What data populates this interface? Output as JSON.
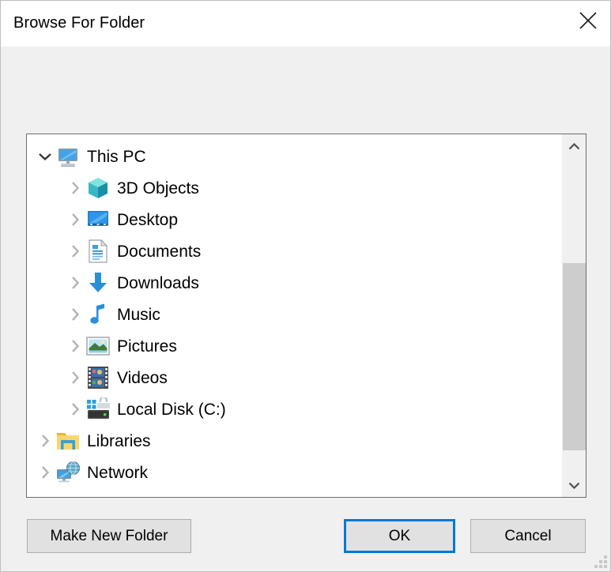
{
  "dialog": {
    "title": "Browse For Folder",
    "close_icon": "close-x-icon"
  },
  "tree": {
    "items": [
      {
        "label": "This PC",
        "depth": 0,
        "state": "expanded",
        "icon": "this-pc-monitor-icon"
      },
      {
        "label": "3D Objects",
        "depth": 1,
        "state": "collapsed",
        "icon": "3d-objects-cube-icon"
      },
      {
        "label": "Desktop",
        "depth": 1,
        "state": "collapsed",
        "icon": "desktop-monitor-icon"
      },
      {
        "label": "Documents",
        "depth": 1,
        "state": "collapsed",
        "icon": "documents-page-icon"
      },
      {
        "label": "Downloads",
        "depth": 1,
        "state": "collapsed",
        "icon": "downloads-arrow-icon"
      },
      {
        "label": "Music",
        "depth": 1,
        "state": "collapsed",
        "icon": "music-note-icon"
      },
      {
        "label": "Pictures",
        "depth": 1,
        "state": "collapsed",
        "icon": "pictures-photo-icon"
      },
      {
        "label": "Videos",
        "depth": 1,
        "state": "collapsed",
        "icon": "videos-filmstrip-icon"
      },
      {
        "label": "Local Disk (C:)",
        "depth": 1,
        "state": "collapsed",
        "icon": "local-disk-drive-icon"
      },
      {
        "label": "Libraries",
        "depth": 0,
        "state": "collapsed",
        "icon": "libraries-folder-icon"
      },
      {
        "label": "Network",
        "depth": 0,
        "state": "collapsed",
        "icon": "network-globe-icon"
      }
    ]
  },
  "scrollbar": {
    "up_arrow_icon": "chevron-up-icon",
    "down_arrow_icon": "chevron-down-icon"
  },
  "buttons": {
    "make_new_folder": "Make New Folder",
    "ok": "OK",
    "cancel": "Cancel"
  },
  "colors": {
    "accent": "#0078d7",
    "dialog_bg": "#f0f0f0",
    "treeview_bg": "#ffffff",
    "treeview_border": "#6d6d6d",
    "button_face": "#e1e1e1",
    "button_border": "#adadad",
    "scroll_thumb": "#cdcdcd"
  }
}
